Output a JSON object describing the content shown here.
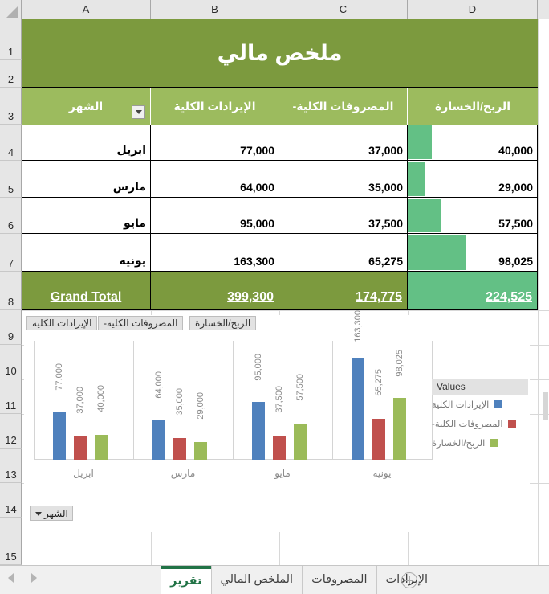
{
  "app": {
    "type": "spreadsheet"
  },
  "grid": {
    "columns": [
      "A",
      "B",
      "C",
      "D"
    ],
    "row_numbers": [
      "1",
      "2",
      "3",
      "4",
      "5",
      "6",
      "7",
      "8",
      "9",
      "10",
      "11",
      "12",
      "13",
      "14",
      "15"
    ]
  },
  "sheet": {
    "title": "ملخص مالي",
    "headers": {
      "month": "الشهر",
      "total_revenue": "الإيرادات الكلية",
      "total_expenses": "المصروفات الكلية-",
      "profit_loss": "الربح/الخسارة"
    },
    "rows": [
      {
        "month": "ابريل",
        "revenue": "77,000",
        "expenses": "37,000",
        "profit": "40,000",
        "profit_value": 40000
      },
      {
        "month": "مارس",
        "revenue": "64,000",
        "expenses": "35,000",
        "profit": "29,000",
        "profit_value": 29000
      },
      {
        "month": "مايو",
        "revenue": "95,000",
        "expenses": "37,500",
        "profit": "57,500",
        "profit_value": 57500
      },
      {
        "month": "يونيه",
        "revenue": "163,300",
        "expenses": "65,275",
        "profit": "98,025",
        "profit_value": 98025
      }
    ],
    "grand_total": {
      "label": "Grand Total",
      "revenue": "399,300",
      "expenses": "174,775",
      "profit": "224,525"
    }
  },
  "chart_data": {
    "type": "bar",
    "title": "",
    "categories": [
      "ابريل",
      "مارس",
      "مايو",
      "يونيه"
    ],
    "series": [
      {
        "name": "الإيرادات الكلية",
        "color": "#4F81BD",
        "values": [
          77000,
          64000,
          95000,
          163300
        ],
        "labels": [
          "77,000",
          "64,000",
          "95,000",
          "163,300"
        ]
      },
      {
        "name": "المصروفات الكلية-",
        "color": "#C0504D",
        "values": [
          37000,
          35000,
          37500,
          65275
        ],
        "labels": [
          "37,000",
          "35,000",
          "37,500",
          "65,275"
        ]
      },
      {
        "name": "الربح/الخسارة",
        "color": "#9BBB59",
        "values": [
          40000,
          29000,
          57500,
          98025
        ],
        "labels": [
          "40,000",
          "29,000",
          "57,500",
          "98,025"
        ]
      }
    ],
    "ylim": [
      0,
      180000
    ],
    "xlabel": "الشهر",
    "ylabel": "",
    "grid": false,
    "legend_position": "right",
    "legend_title": "Values",
    "field_buttons": [
      "الربح/الخسارة",
      "المصروفات الكلية-",
      "الإيرادات الكلية"
    ],
    "axis_field_button": "الشهر"
  },
  "tabs": {
    "items": [
      {
        "label": "الإيرادات",
        "active": false
      },
      {
        "label": "المصروفات",
        "active": false
      },
      {
        "label": "الملخص المالي",
        "active": false
      },
      {
        "label": "تقرير",
        "active": true
      }
    ],
    "add_label": "+"
  },
  "colors": {
    "title_band": "#7C9A3E",
    "header_band": "#9CBB59",
    "data_bar": "#63C085",
    "accent_tab": "#217346"
  }
}
